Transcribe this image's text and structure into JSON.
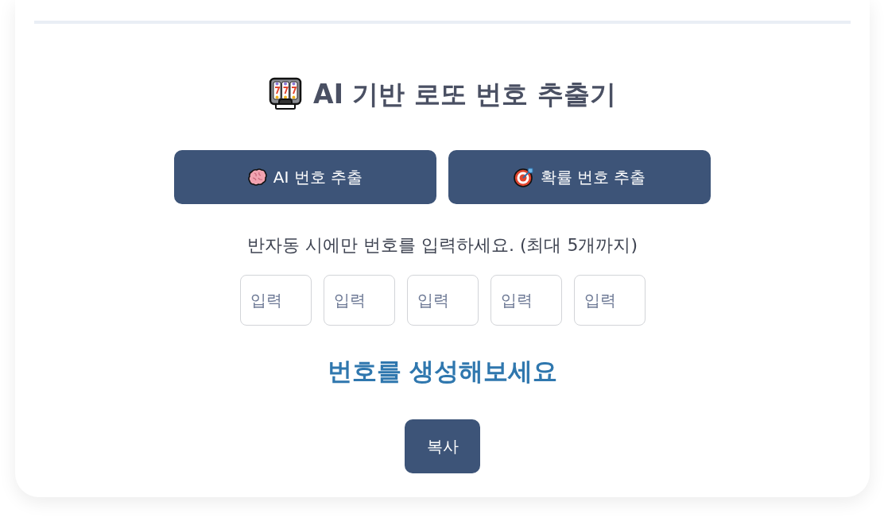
{
  "title": "AI 기반 로또 번호 추출기",
  "buttons": [
    {
      "kind": "ai",
      "label": "AI 번호 추출"
    },
    {
      "kind": "probability",
      "label": "확률 번호 추출"
    }
  ],
  "hint": "반자동 시에만 번호를 입력하세요. (최대 5개까지)",
  "inputs": [
    {
      "placeholder": "입력"
    },
    {
      "placeholder": "입력"
    },
    {
      "placeholder": "입력"
    },
    {
      "placeholder": "입력"
    },
    {
      "placeholder": "입력"
    }
  ],
  "result": "번호를 생성해보세요",
  "copy_button": "복사"
}
